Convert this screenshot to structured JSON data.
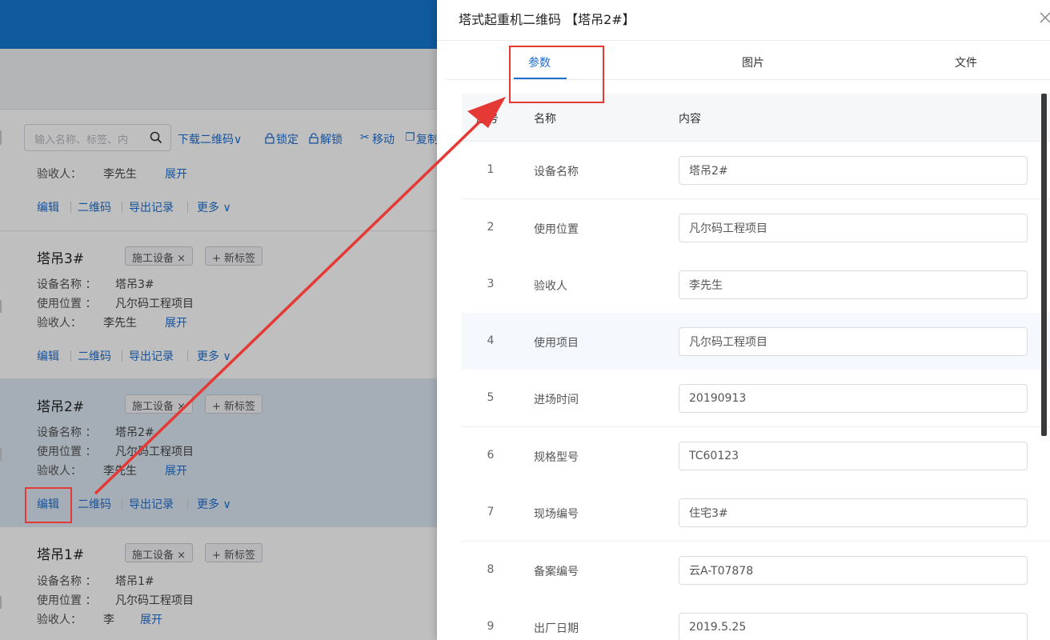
{
  "toolbar": {
    "search_placeholder": "输入名称、标签、内",
    "download_qr": "下载二维码∨",
    "lock": "锁定",
    "unlock": "解锁",
    "move": "移动",
    "copy": "复制"
  },
  "cards": [
    {
      "name": "",
      "rows": [
        {
          "label": "验收人：",
          "value": "李先生"
        }
      ],
      "expand": "展开",
      "actions": {
        "edit": "编辑",
        "qr": "二维码",
        "export": "导出记录",
        "more": "更多 ∨"
      }
    },
    {
      "name": "塔吊3#",
      "tag": "施工设备",
      "tag_close": "×",
      "new_tag": "+ 新标签",
      "rows": [
        {
          "label": "设备名称 ：",
          "value": "塔吊3#"
        },
        {
          "label": "使用位置 ：",
          "value": "凡尔码工程项目"
        },
        {
          "label": "验收人：",
          "value": "李先生"
        }
      ],
      "expand": "展开",
      "actions": {
        "edit": "编辑",
        "qr": "二维码",
        "export": "导出记录",
        "more": "更多 ∨"
      }
    },
    {
      "name": "塔吊2#",
      "tag": "施工设备",
      "tag_close": "×",
      "new_tag": "+ 新标签",
      "rows": [
        {
          "label": "设备名称 ：",
          "value": "塔吊2#"
        },
        {
          "label": "使用位置 ：",
          "value": "凡尔码工程项目"
        },
        {
          "label": "验收人：",
          "value": "李先生"
        }
      ],
      "expand": "展开",
      "actions": {
        "edit": "编辑",
        "qr": "二维码",
        "export": "导出记录",
        "more": "更多 ∨"
      }
    },
    {
      "name": "塔吊1#",
      "tag": "施工设备",
      "tag_close": "×",
      "new_tag": "+ 新标签",
      "rows": [
        {
          "label": "设备名称 ：",
          "value": "塔吊1#"
        },
        {
          "label": "使用位置 ：",
          "value": "凡尔码工程项目"
        },
        {
          "label": "验收人：",
          "value": "李"
        }
      ],
      "expand": "展开"
    }
  ],
  "drawer": {
    "title": "塔式起重机二维码 【塔吊2#】",
    "tabs": [
      "参数",
      "图片",
      "文件"
    ],
    "columns": {
      "no": "序号",
      "name": "名称",
      "content": "内容"
    },
    "rows": [
      {
        "no": "1",
        "name": "设备名称",
        "value": "塔吊2#"
      },
      {
        "no": "2",
        "name": "使用位置",
        "value": "凡尔码工程项目"
      },
      {
        "no": "3",
        "name": "验收人",
        "value": "李先生"
      },
      {
        "no": "4",
        "name": "使用项目",
        "value": "凡尔码工程项目"
      },
      {
        "no": "5",
        "name": "进场时间",
        "value": "20190913"
      },
      {
        "no": "6",
        "name": "规格型号",
        "value": "TC60123"
      },
      {
        "no": "7",
        "name": "现场编号",
        "value": "住宅3#"
      },
      {
        "no": "8",
        "name": "备案编号",
        "value": "云A-T07878"
      },
      {
        "no": "9",
        "name": "出厂日期",
        "value": "2019.5.25"
      }
    ]
  },
  "colors": {
    "brand": "#1577d2",
    "link": "#1e6fd0",
    "annotation": "#e53935"
  }
}
